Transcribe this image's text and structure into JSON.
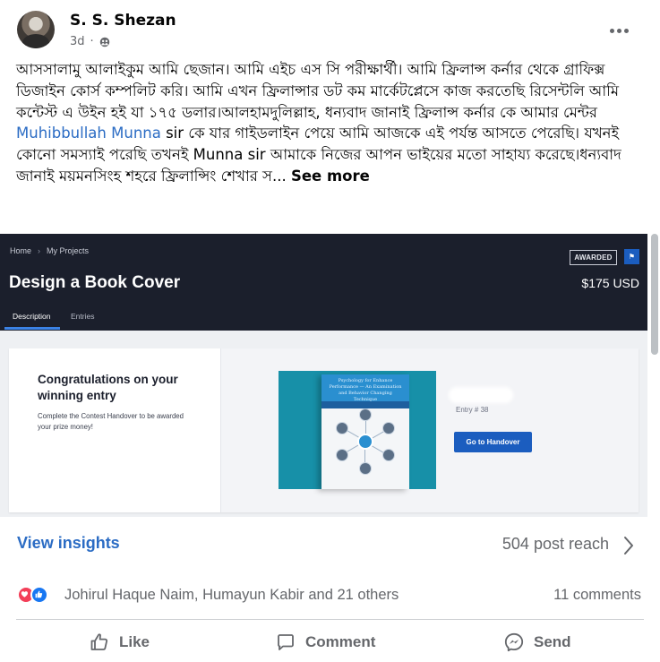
{
  "post": {
    "author": "S. S. Shezan",
    "time": "3d",
    "text_parts": {
      "before_mention": "আসসালামু আলাইকুম আমি ছেজান। আমি এইচ এস সি পরীক্ষার্থী। আমি ফ্রিলান্স কর্নার থেকে গ্রাফিক্স ডিজাইন কোর্স কম্পলিট করি।  আমি এখন ফ্রিলান্সার ডট কম মার্কেটপ্লেসে কাজ করতেছি রিসেন্টলি আমি কন্টেস্ট এ উইন হই  যা ১৭৫ ডলার।আলহামদুলিল্লাহ, ধন্যবাদ জানাই ফ্রিলান্স কর্নার কে আমার মেন্টর ",
      "mention": "Muhibbullah Munna",
      "after_mention": " sir কে যার গাইডলাইন পেয়ে আমি আজকে এই পর্যন্ত আসতে পেরেছি। যখনই কোনো সমস্যাই পরেছি তখনই Munna sir আমাকে নিজের আপন ভাইয়ের মতো সাহায্য করেছে।ধন্যবাদ জানাই ময়মনসিংহ শহরে  ফ্রিলান্সিং শেখার স...",
      "see_more": "See more"
    }
  },
  "screenshot": {
    "breadcrumbs": [
      "Home",
      "My Projects"
    ],
    "badge": "AWARDED",
    "flag": "⚑",
    "title": "Design a Book Cover",
    "prize": "$175 USD",
    "tabs": [
      "Description",
      "Entries"
    ],
    "congrats_title": "Congratulations on your winning entry",
    "congrats_note": "Complete the Contest Handover to be awarded your prize money!",
    "book_text": "Psychology for Enhance Performance — An Examination and Behavior Changing Technique",
    "entry_label": "Entry # 38",
    "handover_button": "Go to Handover"
  },
  "stats": {
    "insights_label": "View insights",
    "reach": "504 post reach",
    "reactors": "Johirul Haque Naim, Humayun Kabir and 21 others",
    "comments": "11 comments"
  },
  "actions": {
    "like": "Like",
    "comment": "Comment",
    "send": "Send"
  },
  "colors": {
    "link": "#2b6cc4",
    "dark_header": "#1b1f2c",
    "handover_blue": "#1b5dbf",
    "love": "#f33e58",
    "like": "#1877f2"
  }
}
